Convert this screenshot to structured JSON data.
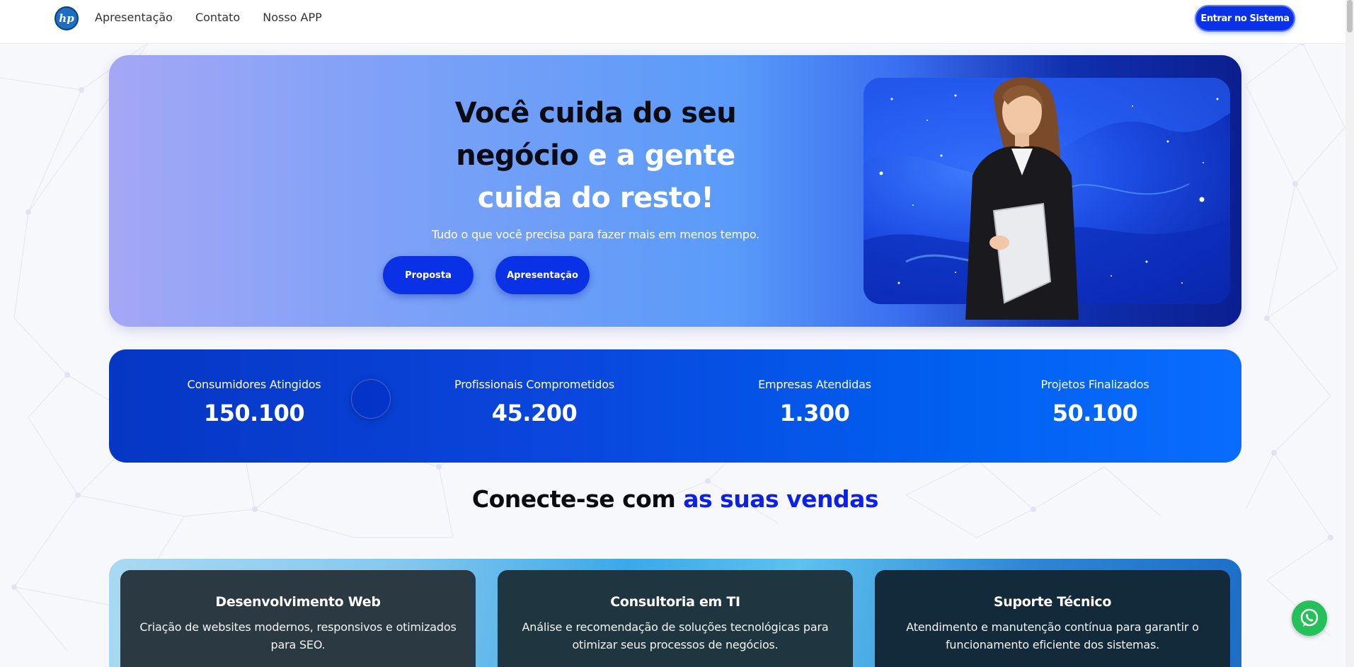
{
  "header": {
    "logo_text": "hp",
    "nav": [
      "Apresentação",
      "Contato",
      "Nosso APP"
    ],
    "cta": "Entrar no Sistema"
  },
  "hero": {
    "title_dark_1": "Você cuida do seu",
    "title_dark_2": "negócio",
    "title_light_1": " e a gente",
    "title_light_2": "cuida do resto!",
    "subtitle": "Tudo o que você precisa para fazer mais em menos tempo.",
    "btn_proposta": "Proposta",
    "btn_apresentacao": "Apresentação"
  },
  "stats": [
    {
      "label": "Consumidores Atingidos",
      "value": "150.100"
    },
    {
      "label": "Profissionais Comprometidos",
      "value": "45.200"
    },
    {
      "label": "Empresas Atendidas",
      "value": "1.300"
    },
    {
      "label": "Projetos Finalizados",
      "value": "50.100"
    }
  ],
  "section": {
    "title_dark": "Conecte-se com ",
    "title_highlight": "as suas vendas"
  },
  "services": [
    {
      "title": "Desenvolvimento Web",
      "desc": "Criação de websites modernos, responsivos e otimizados para SEO."
    },
    {
      "title": "Consultoria em TI",
      "desc": "Análise e recomendação de soluções tecnológicas para otimizar seus processos de negócios."
    },
    {
      "title": "Suporte Técnico",
      "desc": "Atendimento e manutenção contínua para garantir o funcionamento eficiente dos sistemas."
    }
  ],
  "icons": {
    "logo": "hp-logo-icon",
    "whatsapp": "whatsapp-icon"
  },
  "colors": {
    "primary": "#0a31e6",
    "highlight": "#0c20e8",
    "whatsapp": "#25c05a"
  }
}
